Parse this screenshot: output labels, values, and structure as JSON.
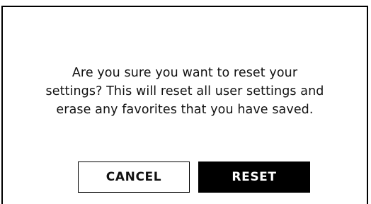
{
  "dialog": {
    "message_lines": [
      "Are you sure you want to reset your",
      "settings? This will reset all user settings and",
      "erase any favorites that you have saved."
    ],
    "cancel_label": "CANCEL",
    "reset_label": "RESET"
  }
}
